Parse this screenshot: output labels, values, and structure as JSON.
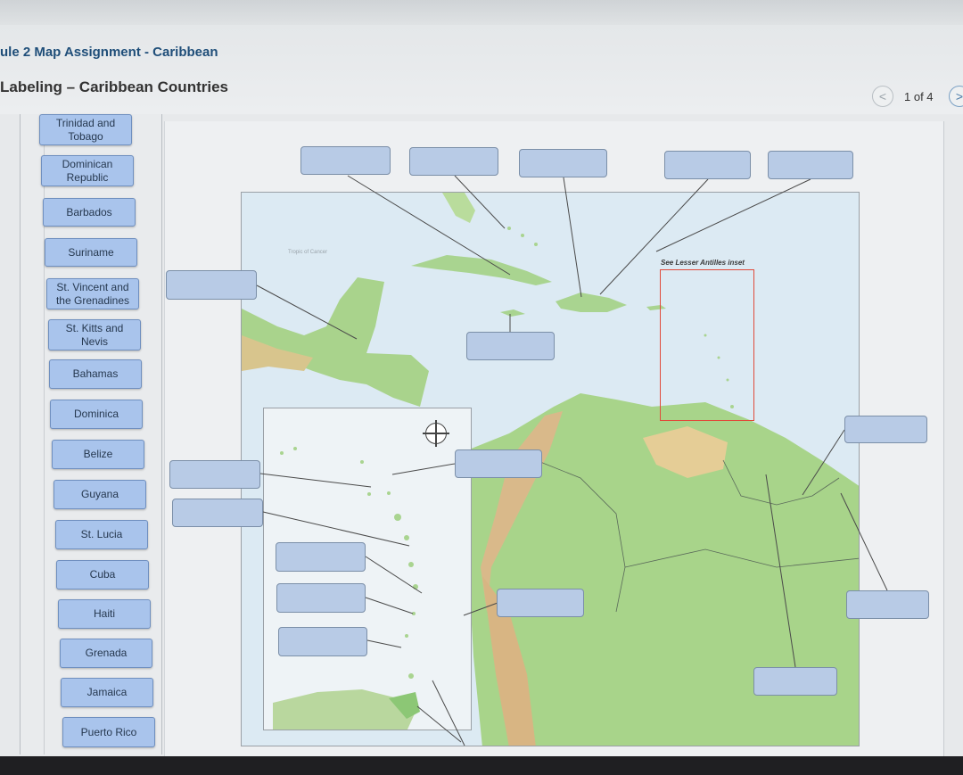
{
  "header": {
    "module_title": "ule 2 Map Assignment - Caribbean",
    "page_title": "Labeling – Caribbean Countries",
    "pager": {
      "prev": "<",
      "text": "1 of 4",
      "next": ">"
    }
  },
  "labels": [
    "Trinidad and Tobago",
    "Dominican Republic",
    "Barbados",
    "Suriname",
    "St. Vincent and the Grenadines",
    "St. Kitts and Nevis",
    "Bahamas",
    "Dominica",
    "Belize",
    "Guyana",
    "St. Lucia",
    "Cuba",
    "Haiti",
    "Grenada",
    "Jamaica",
    "Puerto Rico"
  ],
  "map": {
    "tropic_label": "Tropic of Cancer",
    "antilles_label": "See Lesser Antilles inset"
  },
  "colors": {
    "chip": "#a9c4ec",
    "drop_target": "#b8cbe6",
    "ocean": "#dbe9f2",
    "land": "#9fd18a",
    "inset_box": "#e04a3a"
  }
}
